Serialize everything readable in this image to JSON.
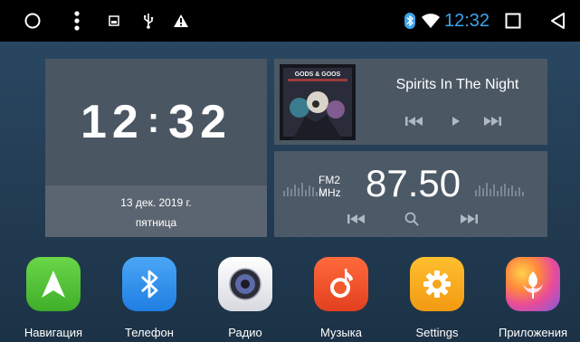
{
  "status_bar": {
    "time": "12:32",
    "colors": {
      "time": "#3ea3e8",
      "bluetooth": "#3ea3e8"
    },
    "icons": [
      "home-circle-icon",
      "menu-dots-icon",
      "screenshot-icon",
      "usb-icon",
      "warning-icon",
      "bluetooth-icon",
      "wifi-icon",
      "recent-apps-icon",
      "back-icon"
    ]
  },
  "clock_widget": {
    "hours": "12",
    "separator": ":",
    "minutes": "32",
    "date": "13 дек. 2019 г.",
    "weekday": "пятница"
  },
  "music_widget": {
    "track_title": "Spirits In The Night",
    "album_art_text": "GODS & GOOS"
  },
  "radio_widget": {
    "band": "FM2",
    "unit": "MHz",
    "frequency": "87.50"
  },
  "dock": {
    "apps": [
      {
        "label": "Навигация",
        "icon": "navigation-icon",
        "color": "#5cc93c"
      },
      {
        "label": "Телефон",
        "icon": "bluetooth-icon",
        "color": "#2f8ff0"
      },
      {
        "label": "Радио",
        "icon": "radio-icon",
        "color": "#e9e9ee"
      },
      {
        "label": "Музыка",
        "icon": "music-icon",
        "color": "#f0502a"
      },
      {
        "label": "Settings",
        "icon": "gear-icon",
        "color": "#f6a81c"
      },
      {
        "label": "Приложения",
        "icon": "apps-flower-icon",
        "color": "#e04fa0"
      }
    ]
  }
}
